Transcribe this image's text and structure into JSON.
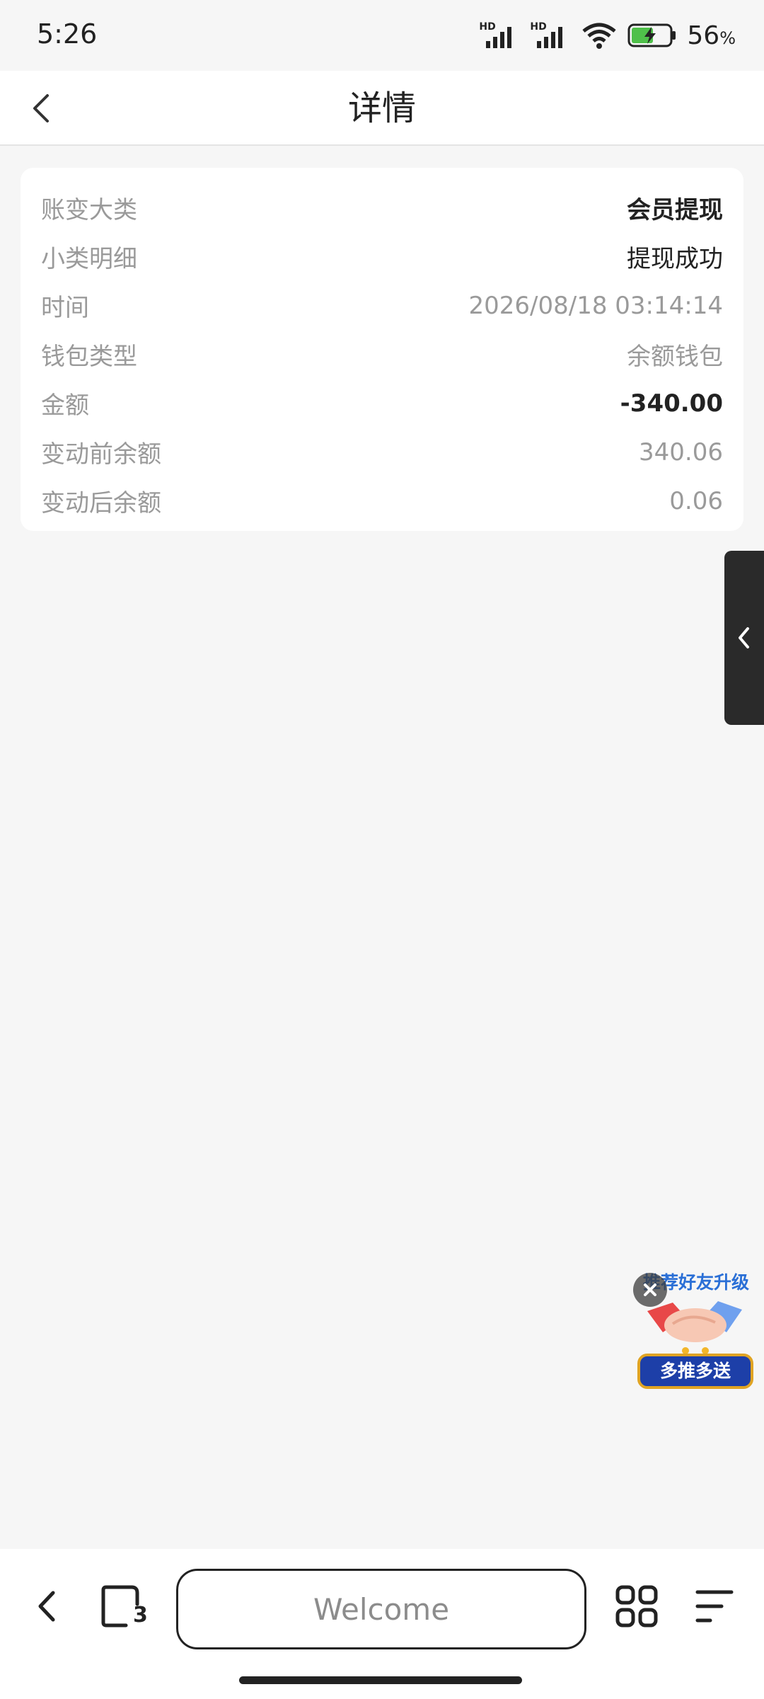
{
  "status_bar": {
    "time": "5:26",
    "signal1_label": "HD",
    "signal2_label": "HD",
    "battery_percent": "56",
    "battery_unit": "%",
    "icons": [
      "signal-icon",
      "signal-icon",
      "wifi-icon",
      "battery-charging-icon"
    ]
  },
  "header": {
    "title": "详情",
    "back_icon": "chevron-left-icon"
  },
  "detail": {
    "rows": [
      {
        "label": "账变大类",
        "value": "会员提现"
      },
      {
        "label": "小类明细",
        "value": "提现成功"
      },
      {
        "label": "时间",
        "value": "2026/08/18 03:14:14"
      },
      {
        "label": "钱包类型",
        "value": "余额钱包"
      },
      {
        "label": "金额",
        "value": "-340.00"
      },
      {
        "label": "变动前余额",
        "value": "340.06"
      },
      {
        "label": "变动后余额",
        "value": "0.06"
      }
    ]
  },
  "side_drawer": {
    "icon": "chevron-left-icon"
  },
  "promo": {
    "title": "推荐好友升级",
    "banner": "多推多送",
    "icon": "handshake-icon"
  },
  "bottom_bar": {
    "address_text": "Welcome",
    "tab_count": "3",
    "icons": [
      "back-icon",
      "tabs-icon",
      "apps-icon",
      "menu-icon"
    ]
  },
  "colors": {
    "background": "#f6f6f6",
    "card": "#ffffff",
    "label_gray": "#9a9a9a",
    "text_dark": "#222222",
    "promo_blue": "#1d3fa8",
    "promo_gold": "#e0a423"
  }
}
